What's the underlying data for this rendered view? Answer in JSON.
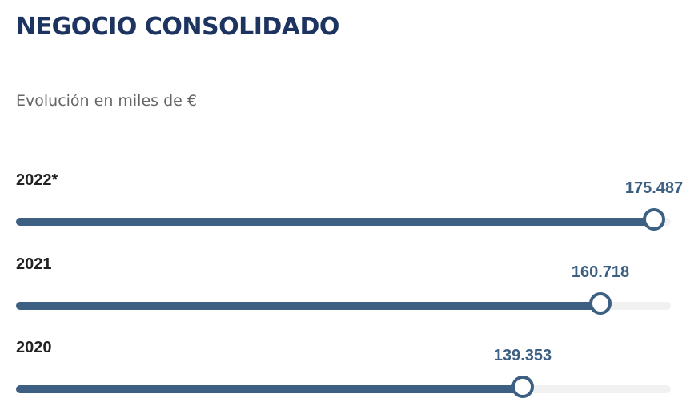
{
  "header": {
    "title": "NEGOCIO CONSOLIDADO",
    "subtitle": "Evolución en miles de €"
  },
  "colors": {
    "title": "#1d3461",
    "bar": "#3d5f82",
    "track": "#f1f1f1",
    "value_text": "#3d5f82"
  },
  "chart_data": {
    "type": "bar",
    "orientation": "horizontal",
    "title": "NEGOCIO CONSOLIDADO",
    "subtitle": "Evolución en miles de €",
    "categories": [
      "2022*",
      "2021",
      "2020"
    ],
    "values": [
      175487,
      160718,
      139353
    ],
    "value_labels": [
      "175.487",
      "160.718",
      "139.353"
    ],
    "xlim": [
      0,
      180000
    ],
    "grid": false,
    "legend": "none"
  }
}
